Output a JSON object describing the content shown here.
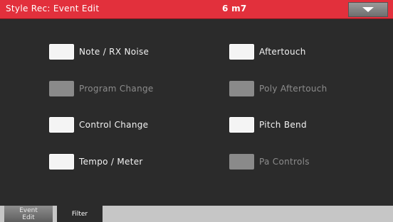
{
  "header": {
    "title": "Style Rec: Event Edit",
    "tempo": "6 m7",
    "menu_icon": "triangle-down"
  },
  "filters": [
    {
      "label": "Note / RX Noise",
      "checked": true
    },
    {
      "label": "Program Change",
      "checked": false
    },
    {
      "label": "Control Change",
      "checked": true
    },
    {
      "label": "Tempo / Meter",
      "checked": true
    },
    {
      "label": "Aftertouch",
      "checked": true
    },
    {
      "label": "Poly Aftertouch",
      "checked": false
    },
    {
      "label": "Pitch Bend",
      "checked": true
    },
    {
      "label": "Pa Controls",
      "checked": false
    }
  ],
  "tabs": [
    {
      "label_line1": "Event",
      "label_line2": "Edit",
      "active": false
    },
    {
      "label": "Filter",
      "active": true
    }
  ],
  "colors": {
    "title_bar": "#e2303c",
    "background": "#2b2b2b",
    "checkbox_on": "#f4f4f4",
    "checkbox_off": "#8a8a8a"
  }
}
